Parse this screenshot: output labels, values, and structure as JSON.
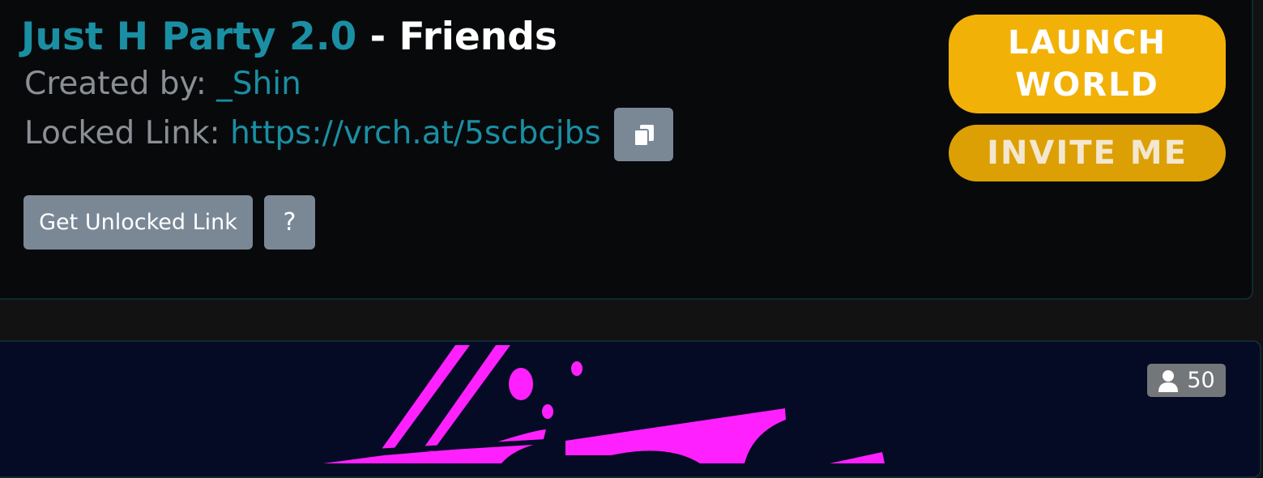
{
  "world": {
    "name": "Just H Party 2.0",
    "instance_type": " - Friends",
    "created_by_label": "Created by: ",
    "creator": "_Shin",
    "locked_link_label": "Locked Link: ",
    "locked_link": "https://vrch.at/5scbcjbs"
  },
  "buttons": {
    "get_unlocked_link": "Get Unlocked Link",
    "help": "?",
    "launch_world_line1": "LAUNCH",
    "launch_world_line2": "WORLD",
    "invite_me": "INVITE ME"
  },
  "preview": {
    "player_count": "50",
    "art_color": "#ff20ff",
    "background_color": "#050b24"
  },
  "colors": {
    "accent_teal": "#1a8fa3",
    "launch_gold": "#f2b106",
    "invite_gold": "#dca005",
    "button_gray": "#7a8896"
  },
  "icons": {
    "copy": "copy-icon",
    "player": "user-icon"
  }
}
